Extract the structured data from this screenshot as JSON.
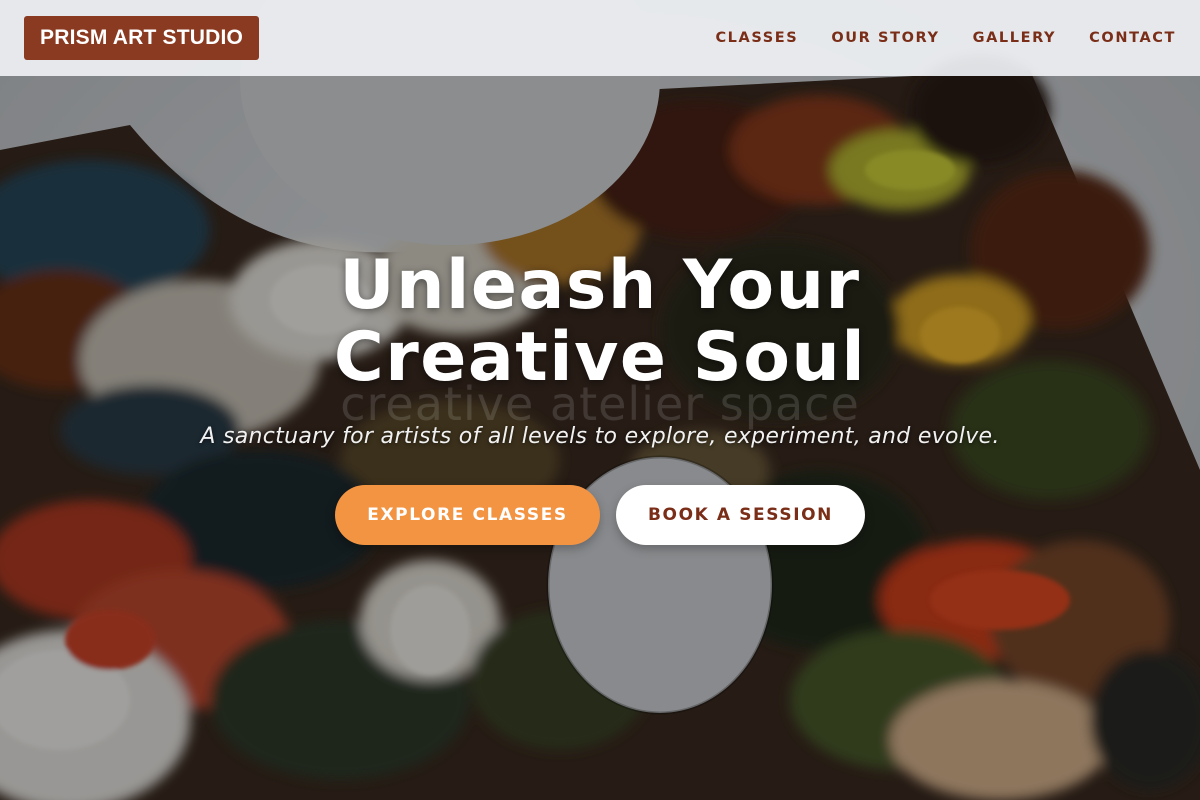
{
  "brand": {
    "name": "PRISM ART STUDIO",
    "color": "#8b3a22"
  },
  "nav": {
    "links": [
      {
        "label": "CLASSES"
      },
      {
        "label": "OUR STORY"
      },
      {
        "label": "GALLERY"
      },
      {
        "label": "CONTACT"
      }
    ],
    "text_color": "#7a2e18"
  },
  "hero": {
    "title_line1": "Unleash Your",
    "title_line2": "Creative Soul",
    "ghost_text": "creative atelier space",
    "subtitle": "A sanctuary for artists of all levels to explore, experiment, and evolve.",
    "background_image": "paint-palette-photo",
    "buttons": {
      "primary": {
        "label": "EXPLORE CLASSES",
        "color": "#f39443"
      },
      "secondary": {
        "label": "BOOK A SESSION",
        "color": "#ffffff"
      }
    }
  }
}
